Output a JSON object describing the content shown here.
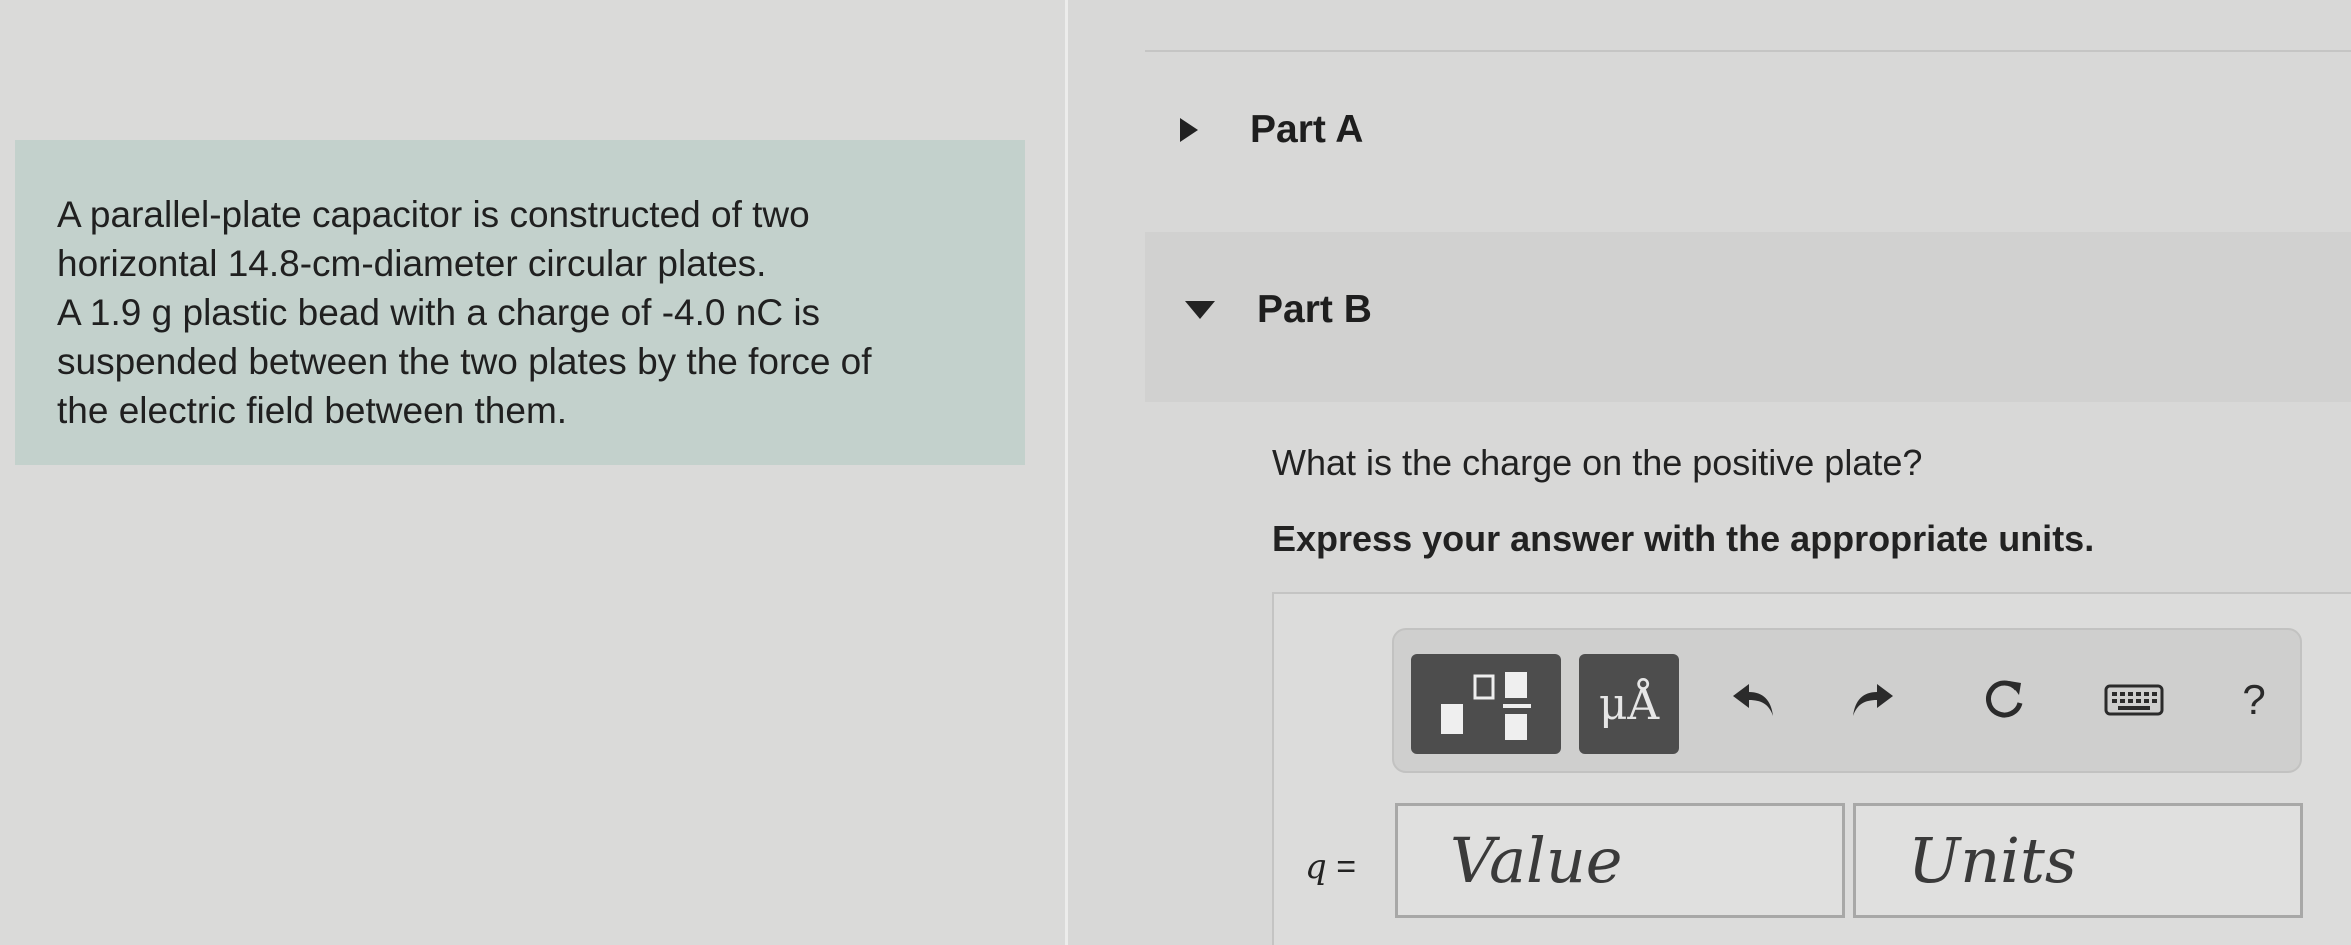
{
  "problem": {
    "lines": [
      "A parallel-plate capacitor is constructed of two",
      "horizontal 14.8-cm-diameter circular plates.",
      "A 1.9 g plastic bead with a charge of -4.0 nC is",
      "suspended between the two plates by the force of",
      "the electric field between them."
    ]
  },
  "parts": {
    "part_a_label": "Part A",
    "part_b_label": "Part B"
  },
  "question": {
    "text": "What is the charge on the positive plate?",
    "instruction": "Express your answer with the appropriate units."
  },
  "toolbar": {
    "units_button_label": "μÅ",
    "help_label": "?",
    "icons": [
      "template-icon",
      "units-icon",
      "undo-icon",
      "redo-icon",
      "reset-icon",
      "keyboard-icon",
      "help-icon"
    ]
  },
  "answer": {
    "variable": "q",
    "equals": "=",
    "value_placeholder": "Value",
    "units_placeholder": "Units"
  }
}
